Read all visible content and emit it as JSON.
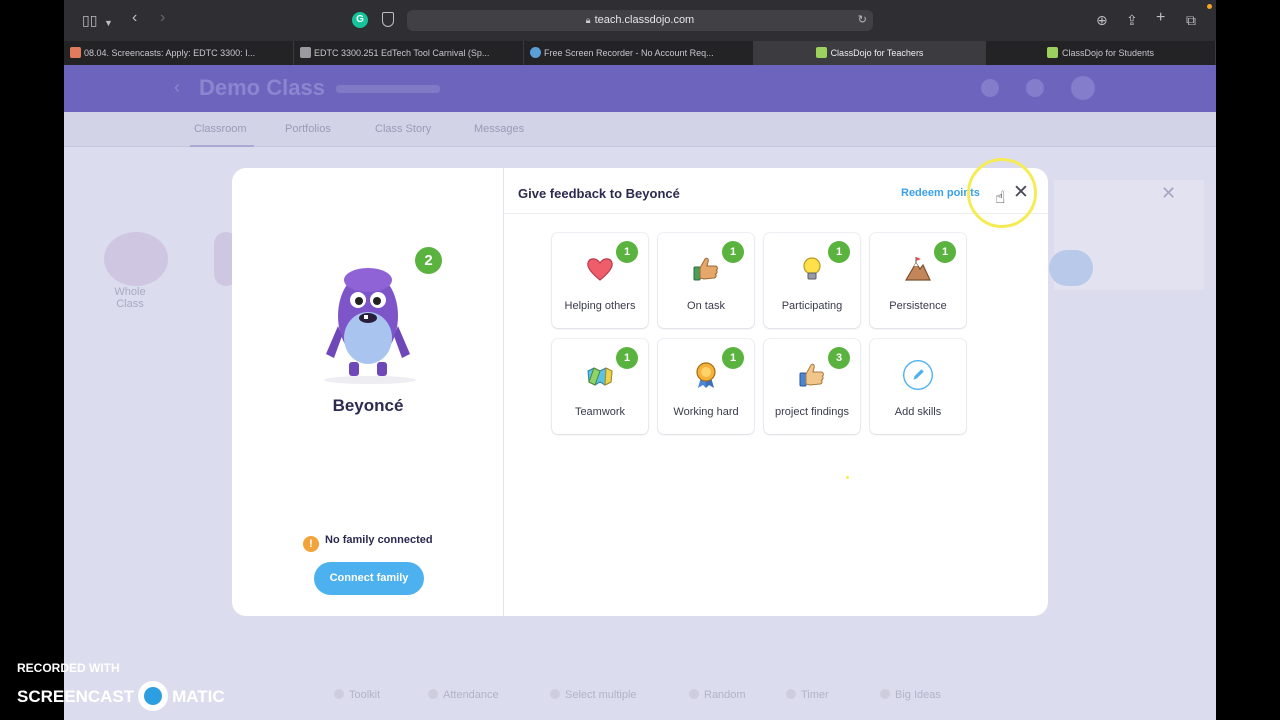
{
  "browser": {
    "url": "teach.classdojo.com",
    "tabs": [
      {
        "label": "08.04. Screencasts: Apply: EDTC 3300: I...",
        "active": false
      },
      {
        "label": "EDTC 3300.251 EdTech Tool Carnival (Sp...",
        "active": false
      },
      {
        "label": "Free Screen Recorder - No Account Req...",
        "active": false
      },
      {
        "label": "ClassDojo for Teachers",
        "active": true
      },
      {
        "label": "ClassDojo for Students",
        "active": false
      }
    ]
  },
  "background_page": {
    "title": "Demo Class",
    "nav": [
      "Classroom",
      "Portfolios",
      "Class Story",
      "Messages"
    ],
    "whole_class_label": "Whole Class",
    "bottom_tools": [
      "Toolkit",
      "Attendance",
      "Select multiple",
      "Random",
      "Timer",
      "Big Ideas"
    ]
  },
  "modal": {
    "student_name": "Beyoncé",
    "total_points": "2",
    "family_status": "No family connected",
    "connect_button": "Connect family",
    "title": "Give feedback to Beyoncé",
    "redeem_link": "Redeem points",
    "close_icon": "close-icon",
    "skills": [
      {
        "label": "Helping others",
        "count": "1",
        "icon": "heart-icon"
      },
      {
        "label": "On task",
        "count": "1",
        "icon": "thumbs-up-icon"
      },
      {
        "label": "Participating",
        "count": "1",
        "icon": "lightbulb-icon"
      },
      {
        "label": "Persistence",
        "count": "1",
        "icon": "mountain-icon"
      },
      {
        "label": "Teamwork",
        "count": "1",
        "icon": "teamwork-icon"
      },
      {
        "label": "Working hard",
        "count": "1",
        "icon": "medal-icon"
      },
      {
        "label": "project findings",
        "count": "3",
        "icon": "thumbs-up-icon"
      },
      {
        "label": "Add skills",
        "count": null,
        "icon": "pencil-icon"
      }
    ]
  },
  "watermark": {
    "recorded_with": "RECORDED WITH",
    "brand_left": "SCREENCAST",
    "brand_right": "MATIC"
  },
  "colors": {
    "accent_green": "#5bb33f",
    "accent_blue": "#4db1ef",
    "header_purple": "#6d65bd"
  }
}
